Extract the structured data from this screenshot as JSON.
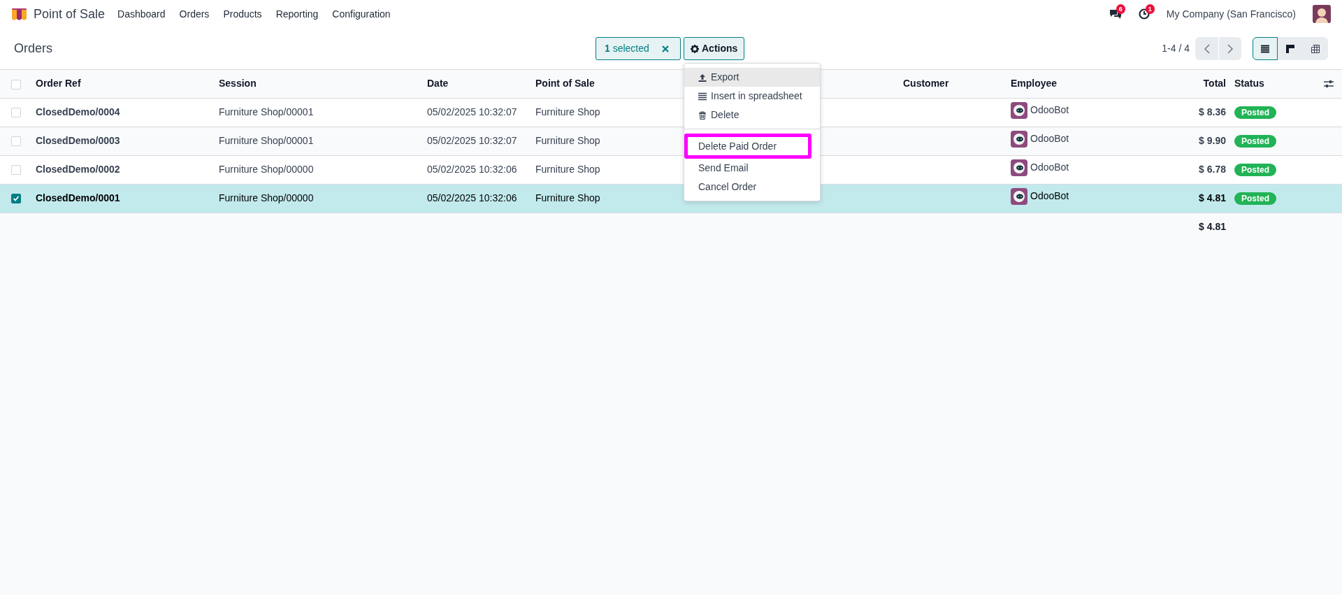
{
  "app": {
    "name": "Point of Sale"
  },
  "menu": [
    "Dashboard",
    "Orders",
    "Products",
    "Reporting",
    "Configuration"
  ],
  "systray": {
    "messages_count": "6",
    "activities_count": "1",
    "company": "My Company (San Francisco)"
  },
  "breadcrumb": "Orders",
  "selection": {
    "label": "**1** selected"
  },
  "actions_button": "Actions",
  "actions_menu": {
    "sections": [
      {
        "items": [
          {
            "label": "Export",
            "kind": "export",
            "hovered": true,
            "highlighted": false
          },
          {
            "label": "Insert in spreadsheet",
            "kind": "spreadsheet",
            "hovered": false,
            "highlighted": false
          },
          {
            "label": "Delete",
            "kind": "delete",
            "hovered": false,
            "highlighted": false
          }
        ]
      },
      {
        "items": [
          {
            "label": "Delete Paid Order",
            "kind": "plain",
            "hovered": false,
            "highlighted": true
          },
          {
            "label": "Send Email",
            "kind": "plain",
            "hovered": false,
            "highlighted": false
          },
          {
            "label": "Cancel Order",
            "kind": "plain",
            "hovered": false,
            "highlighted": false
          }
        ]
      }
    ]
  },
  "pager": "1-4 / 4",
  "views": [
    {
      "kind": "list",
      "selected": true
    },
    {
      "kind": "kanban",
      "selected": false
    },
    {
      "kind": "pivot",
      "selected": false
    }
  ],
  "table": {
    "all_selected": false,
    "headers": {
      "order_ref": "Order Ref",
      "session": "Session",
      "date": "Date",
      "point_of_sale": "Point of Sale",
      "customer": "Customer",
      "employee": "Employee",
      "total": "Total",
      "status": "Status"
    },
    "rows": [
      {
        "selected": false,
        "order_ref": "ClosedDemo/0004",
        "session": "Furniture Shop/00001",
        "date": "05/02/2025 10:32:07",
        "point_of_sale": "Furniture Shop",
        "employee": "OdooBot",
        "total": "$ 8.36",
        "status": "Posted"
      },
      {
        "selected": false,
        "order_ref": "ClosedDemo/0003",
        "session": "Furniture Shop/00001",
        "date": "05/02/2025 10:32:07",
        "point_of_sale": "Furniture Shop",
        "employee": "OdooBot",
        "total": "$ 9.90",
        "status": "Posted"
      },
      {
        "selected": false,
        "order_ref": "ClosedDemo/0002",
        "session": "Furniture Shop/00000",
        "date": "05/02/2025 10:32:06",
        "point_of_sale": "Furniture Shop",
        "employee": "OdooBot",
        "total": "$ 6.78",
        "status": "Posted"
      },
      {
        "selected": true,
        "order_ref": "ClosedDemo/0001",
        "session": "Furniture Shop/00000",
        "date": "05/02/2025 10:32:06",
        "point_of_sale": "Furniture Shop",
        "employee": "OdooBot",
        "total": "$ 4.81",
        "status": "Posted"
      }
    ],
    "footer_total": "$ 4.81"
  }
}
